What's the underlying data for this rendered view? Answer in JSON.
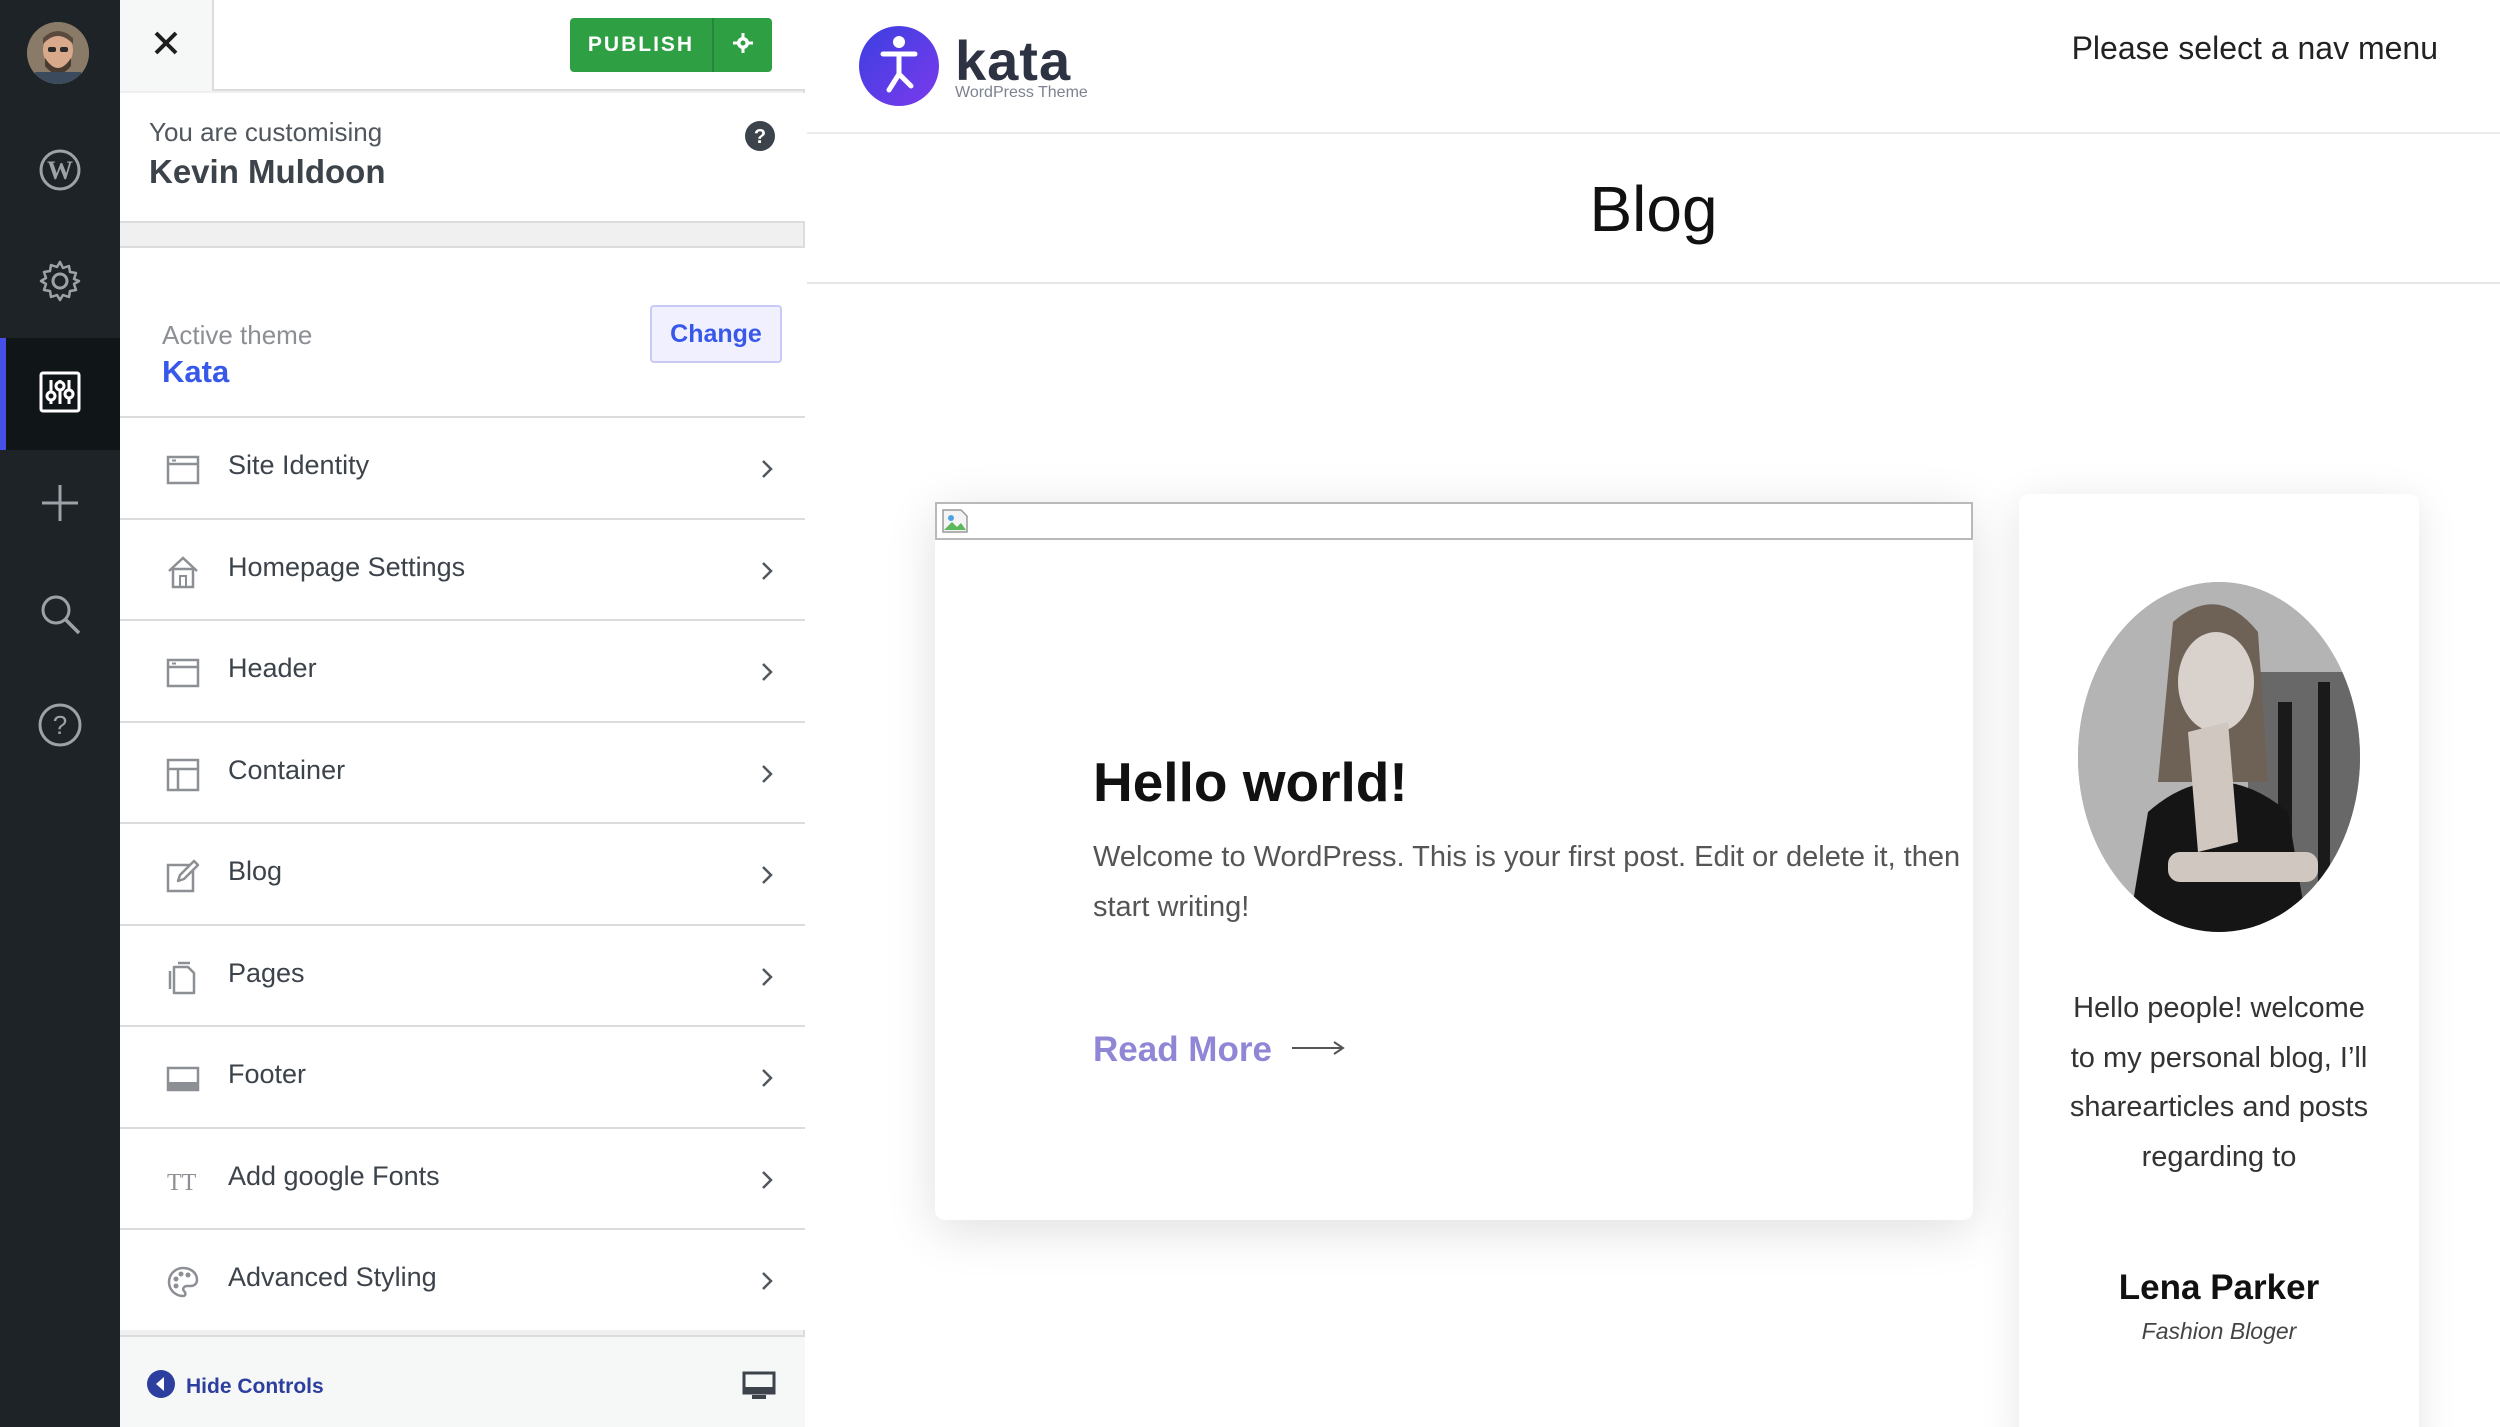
{
  "customizer": {
    "publish_label": "PUBLISH",
    "customising_label": "You are customising",
    "site_name": "Kevin Muldoon",
    "active_theme_label": "Active theme",
    "active_theme": "Kata",
    "change_label": "Change",
    "sections": [
      {
        "label": "Site Identity",
        "icon": "site-identity-icon"
      },
      {
        "label": "Homepage Settings",
        "icon": "home-icon"
      },
      {
        "label": "Header",
        "icon": "header-icon"
      },
      {
        "label": "Container",
        "icon": "container-icon"
      },
      {
        "label": "Blog",
        "icon": "edit-icon"
      },
      {
        "label": "Pages",
        "icon": "pages-icon"
      },
      {
        "label": "Footer",
        "icon": "footer-icon"
      },
      {
        "label": "Add google Fonts",
        "icon": "fonts-icon"
      },
      {
        "label": "Advanced Styling",
        "icon": "palette-icon"
      }
    ],
    "hide_controls_label": "Hide Controls"
  },
  "rail_icons": [
    "avatar",
    "wordpress-icon",
    "gear-icon",
    "customizer-icon",
    "plus-icon",
    "search-icon",
    "help-icon"
  ],
  "preview": {
    "logo_name": "kata",
    "logo_sub": "WordPress Theme",
    "nav_note": "Please select a nav menu",
    "page_title": "Blog",
    "post": {
      "title": "Hello world!",
      "excerpt": "Welcome to WordPress. This is your first post. Edit or delete it, then start writing!",
      "read_more": "Read More"
    },
    "author": {
      "bio": "Hello people! welcome to my personal blog, I’ll sharearticles and posts regarding to",
      "name": "Lena Parker",
      "role": "Fashion Bloger"
    }
  },
  "colors": {
    "publish_green": "#2ea043",
    "accent_blue": "#3858e9",
    "rail_bg": "#1d2327",
    "read_more": "#8f86d6"
  }
}
